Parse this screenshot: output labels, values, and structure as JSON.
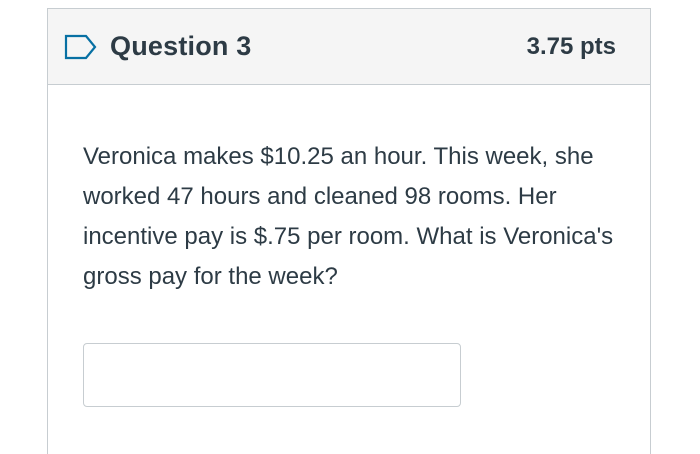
{
  "question": {
    "title": "Question 3",
    "points": "3.75 pts",
    "flag_icon": "flag-outline-icon",
    "text": "Veronica makes $10.25 an hour. This week, she worked 47 hours and cleaned 98 rooms. Her incentive pay is $.75 per room. What is Veronica's gross pay for the week?",
    "answer_value": "",
    "accent_color": "#2d3b45",
    "flag_color": "#0770a3",
    "header_bg": "#f5f5f5"
  }
}
